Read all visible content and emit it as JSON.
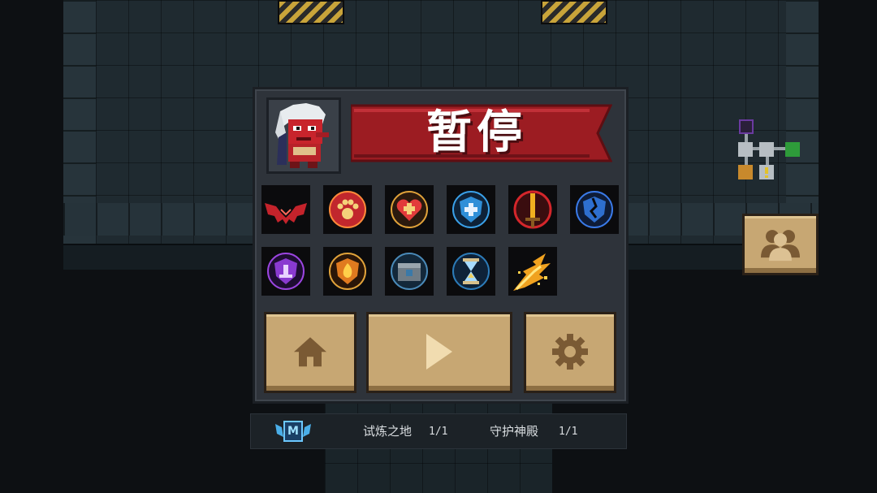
{
  "pause": {
    "title": "暂停"
  },
  "buffs": [
    {
      "icon": "demon-wings-icon",
      "color": "#c4232b"
    },
    {
      "icon": "paw-icon",
      "color": "#e05a2a"
    },
    {
      "icon": "heart-plus-icon",
      "color": "#e23b3b"
    },
    {
      "icon": "shield-plus-icon",
      "color": "#2f8fd8"
    },
    {
      "icon": "flame-sword-icon",
      "color": "#d4262b"
    },
    {
      "icon": "cracked-shield-icon",
      "color": "#2e6fcf"
    },
    {
      "icon": "purple-shield-icon",
      "color": "#8a3ad0"
    },
    {
      "icon": "fire-shield-icon",
      "color": "#e07a1f"
    },
    {
      "icon": "coin-chest-icon",
      "color": "#3a79a8"
    },
    {
      "icon": "hourglass-icon",
      "color": "#2c7bb8"
    },
    {
      "icon": "explosion-icon",
      "color": "#f0a21f"
    }
  ],
  "buttons": {
    "home": "home-icon",
    "resume": "play-icon",
    "settings": "gear-icon"
  },
  "status": {
    "badge": "M",
    "stage1_name": "试炼之地",
    "stage1_count": "1/1",
    "stage2_name": "守护神殿",
    "stage2_count": "1/1"
  },
  "colors": {
    "banner_red": "#9c1c22",
    "button_tan": "#c7a773",
    "panel_bg": "#2e333a"
  }
}
